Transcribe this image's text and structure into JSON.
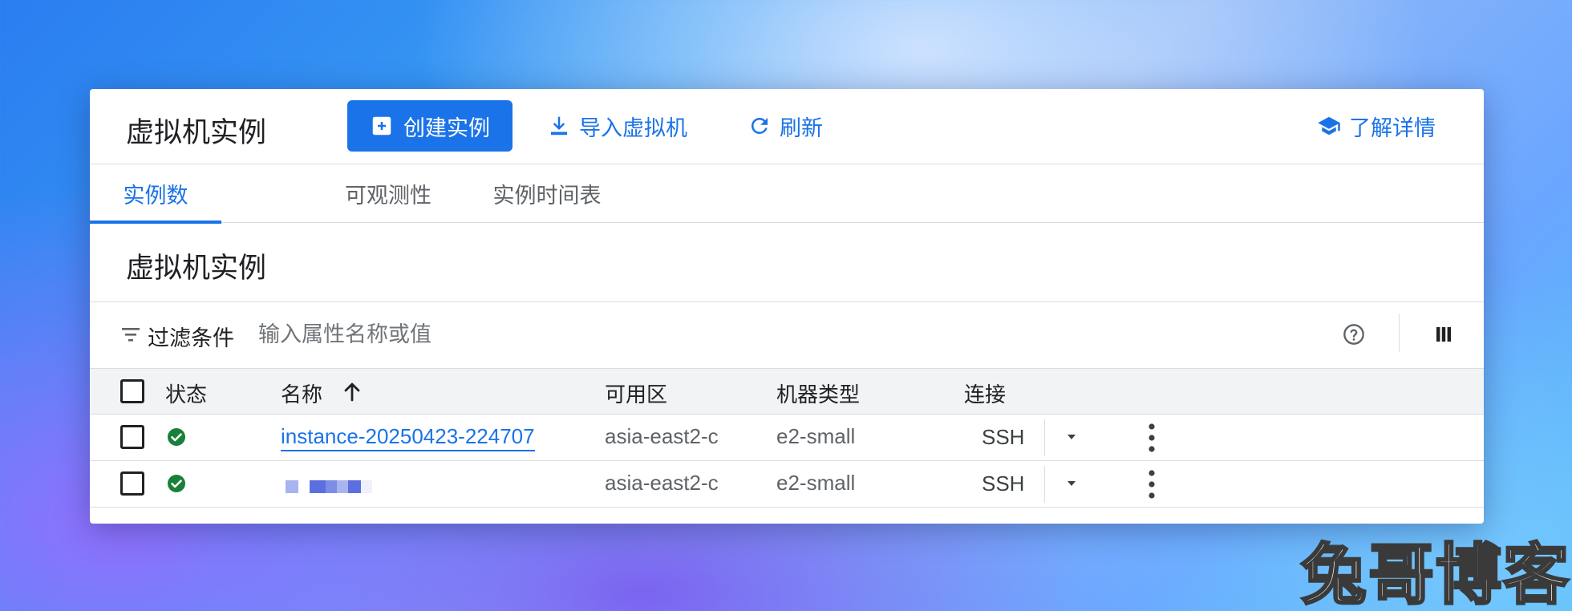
{
  "header": {
    "title": "虚拟机实例",
    "create_label": "创建实例",
    "import_label": "导入虚拟机",
    "refresh_label": "刷新",
    "learn_label": "了解详情"
  },
  "tabs": [
    {
      "label": "实例数",
      "active": true
    },
    {
      "label": "可观测性",
      "active": false
    },
    {
      "label": "实例时间表",
      "active": false
    }
  ],
  "section": {
    "title": "虚拟机实例"
  },
  "filter": {
    "label": "过滤条件",
    "placeholder": "输入属性名称或值"
  },
  "table": {
    "columns": {
      "status": "状态",
      "name": "名称",
      "zone": "可用区",
      "machine_type": "机器类型",
      "connect": "连接"
    },
    "rows": [
      {
        "status": "running",
        "name": "instance-20250423-224707",
        "zone": "asia-east2-c",
        "machine_type": "e2-small",
        "connect": "SSH"
      },
      {
        "status": "running",
        "name": "",
        "zone": "asia-east2-c",
        "machine_type": "e2-small",
        "connect": "SSH"
      }
    ]
  },
  "colors": {
    "accent": "#1a73e8",
    "success": "#188038"
  },
  "watermark": "兔哥博客"
}
